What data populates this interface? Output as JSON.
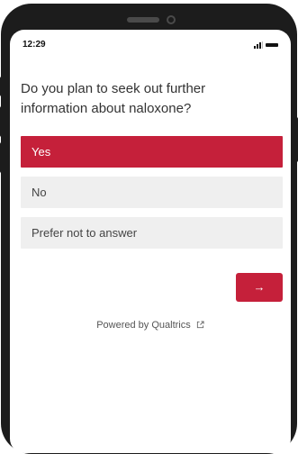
{
  "status_bar": {
    "time": "12:29",
    "signal_icon": "signal-bars-icon",
    "battery_icon": "battery-icon"
  },
  "survey": {
    "question": "Do you plan to seek out further information about naloxone?",
    "choices": [
      {
        "label": "Yes",
        "selected": true
      },
      {
        "label": "No",
        "selected": false
      },
      {
        "label": "Prefer not to answer",
        "selected": false
      }
    ],
    "next_label": "→"
  },
  "footer": {
    "text": "Powered by Qualtrics",
    "icon": "external-link-icon"
  },
  "colors": {
    "accent": "#c5203a",
    "choice_bg": "#efefef",
    "phone_frame": "#1c1c1c"
  }
}
